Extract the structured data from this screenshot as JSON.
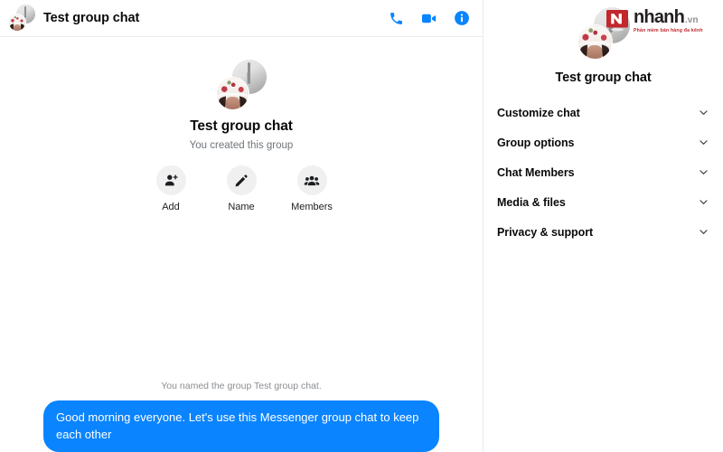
{
  "header": {
    "title": "Test group chat",
    "avatar_icon": "group-avatar",
    "actions": [
      {
        "name": "audio-call-button",
        "icon": "phone-icon",
        "label": "Audio call"
      },
      {
        "name": "video-call-button",
        "icon": "video-camera-icon",
        "label": "Video call"
      },
      {
        "name": "conversation-info-button",
        "icon": "info-circle-icon",
        "label": "Conversation information"
      }
    ]
  },
  "conversation": {
    "intro": {
      "avatar_icon": "group-avatar",
      "name": "Test group chat",
      "subtitle": "You created this group"
    },
    "quick_actions": [
      {
        "name": "add-people-button",
        "icon": "add-person-icon",
        "label": "Add"
      },
      {
        "name": "change-name-button",
        "icon": "pencil-icon",
        "label": "Name"
      },
      {
        "name": "members-button",
        "icon": "members-group-icon",
        "label": "Members"
      }
    ],
    "system_note": "You named the group Test group chat.",
    "messages": [
      {
        "name": "outgoing-message-bubble",
        "text": "Good morning everyone. Let's use this Messenger group chat to keep each other",
        "direction": "outgoing"
      }
    ]
  },
  "details_panel": {
    "avatar_icon": "group-avatar",
    "title": "Test group chat",
    "menu_items": [
      {
        "name": "menu-item-customize-chat",
        "label": "Customize chat",
        "icon": "chevron-down-icon"
      },
      {
        "name": "menu-item-group-options",
        "label": "Group options",
        "icon": "chevron-down-icon"
      },
      {
        "name": "menu-item-chat-members",
        "label": "Chat Members",
        "icon": "chevron-down-icon"
      },
      {
        "name": "menu-item-media-files",
        "label": "Media & files",
        "icon": "chevron-down-icon"
      },
      {
        "name": "menu-item-privacy-support",
        "label": "Privacy & support",
        "icon": "chevron-down-icon"
      }
    ]
  },
  "watermark": {
    "brand": "nhanh",
    "tld": ".vn",
    "tagline": "Phần mềm bán hàng đa kênh"
  },
  "colors": {
    "accent_blue": "#0a84ff",
    "bubble_blue": "#0a84ff",
    "brand_red": "#c1272d",
    "panel_divider": "#e8eaed",
    "muted_text": "#70757a"
  }
}
